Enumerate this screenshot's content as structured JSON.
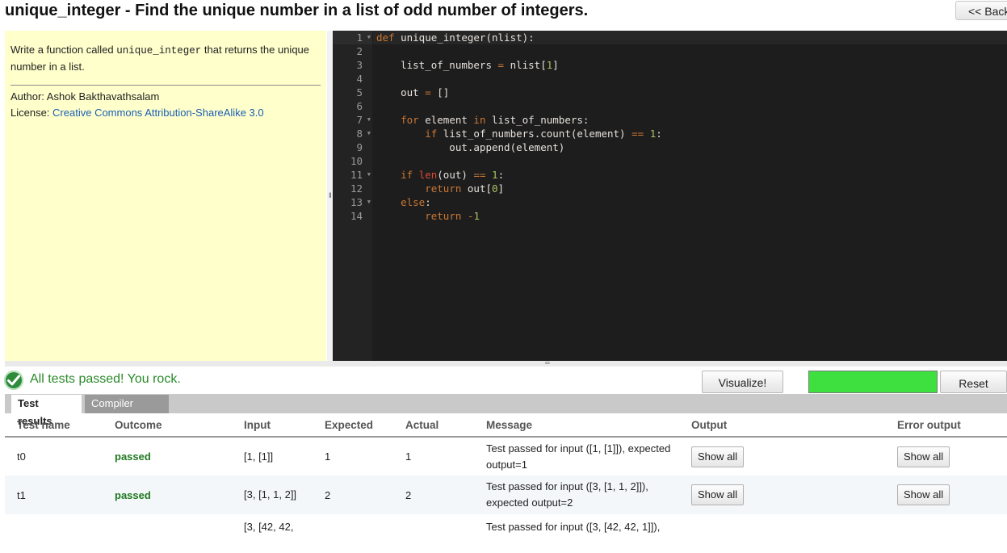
{
  "page": {
    "title": "unique_integer - Find the unique number in a list of odd number of integers.",
    "back_label": "<< Back"
  },
  "description": {
    "prefix": "Write a function called ",
    "function_name": "unique_integer",
    "suffix": " that returns the unique number in a list.",
    "author": "Author: Ashok Bakthavathsalam",
    "license_label": "License: ",
    "license_link": "Creative Commons Attribution-ShareAlike 3.0"
  },
  "editor": {
    "line_numbers": [
      "1",
      "2",
      "3",
      "4",
      "5",
      "6",
      "7",
      "8",
      "9",
      "10",
      "11",
      "12",
      "13",
      "14"
    ]
  },
  "status": {
    "message": "All tests passed! You rock.",
    "progress": 1.0,
    "progress_color": "#3ee040"
  },
  "buttons": {
    "visualize": "Visualize!",
    "reset": "Reset"
  },
  "tabs": {
    "results": "Test results",
    "compiler": "Compiler errors"
  },
  "table": {
    "headers": {
      "name": "Test name",
      "outcome": "Outcome",
      "input": "Input",
      "expected": "Expected",
      "actual": "Actual",
      "message": "Message",
      "output": "Output",
      "error": "Error output"
    },
    "rows": [
      {
        "name": "t0",
        "outcome": "passed",
        "input": "[1, [1]]",
        "expected": "1",
        "actual": "1",
        "message": "Test passed for input ([1, [1]]), expected output=1",
        "output_btn": "Show all",
        "error_btn": "Show all"
      },
      {
        "name": "t1",
        "outcome": "passed",
        "input": "[3, [1, 1, 2]]",
        "expected": "2",
        "actual": "2",
        "message": "Test passed for input ([3, [1, 1, 2]]), expected output=2",
        "output_btn": "Show all",
        "error_btn": "Show all"
      },
      {
        "input": "[3, [42, 42,",
        "message": "Test passed for input ([3, [42, 42, 1]]),"
      }
    ]
  }
}
